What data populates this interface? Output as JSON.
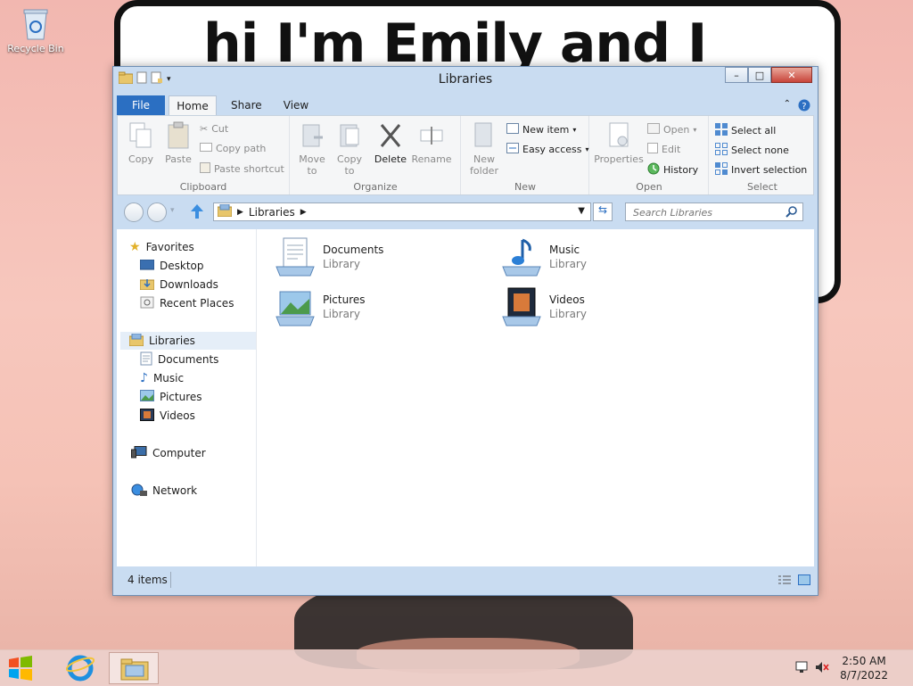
{
  "desktop": {
    "wallpaper_text": "hi I'm Emily and I",
    "recycle_bin_label": "Recycle Bin"
  },
  "window": {
    "title": "Libraries",
    "controls": {
      "minimize": "–",
      "maximize": "□",
      "close": "✕"
    }
  },
  "ribbon": {
    "tabs": {
      "file": "File",
      "home": "Home",
      "share": "Share",
      "view": "View"
    },
    "clipboard": {
      "copy": "Copy",
      "paste": "Paste",
      "cut": "Cut",
      "copy_path": "Copy path",
      "paste_shortcut": "Paste shortcut",
      "label": "Clipboard"
    },
    "organize": {
      "move_to": "Move to",
      "copy_to": "Copy to",
      "delete": "Delete",
      "rename": "Rename",
      "label": "Organize"
    },
    "new": {
      "new_folder": "New folder",
      "new_item": "New item",
      "easy_access": "Easy access",
      "label": "New"
    },
    "open": {
      "properties": "Properties",
      "open": "Open",
      "edit": "Edit",
      "history": "History",
      "label": "Open"
    },
    "select": {
      "select_all": "Select all",
      "select_none": "Select none",
      "invert_selection": "Invert selection",
      "label": "Select"
    }
  },
  "address": {
    "path": "Libraries",
    "search_placeholder": "Search Libraries"
  },
  "nav": {
    "favorites": "Favorites",
    "desktop": "Desktop",
    "downloads": "Downloads",
    "recent_places": "Recent Places",
    "libraries": "Libraries",
    "documents": "Documents",
    "music": "Music",
    "pictures": "Pictures",
    "videos": "Videos",
    "computer": "Computer",
    "network": "Network"
  },
  "items": [
    {
      "name": "Documents",
      "type": "Library"
    },
    {
      "name": "Music",
      "type": "Library"
    },
    {
      "name": "Pictures",
      "type": "Library"
    },
    {
      "name": "Videos",
      "type": "Library"
    }
  ],
  "status": {
    "count": "4 items"
  },
  "taskbar": {
    "time": "2:50 AM",
    "date": "8/7/2022"
  },
  "colors": {
    "accent": "#2b6fc2",
    "close": "#c8443a"
  }
}
